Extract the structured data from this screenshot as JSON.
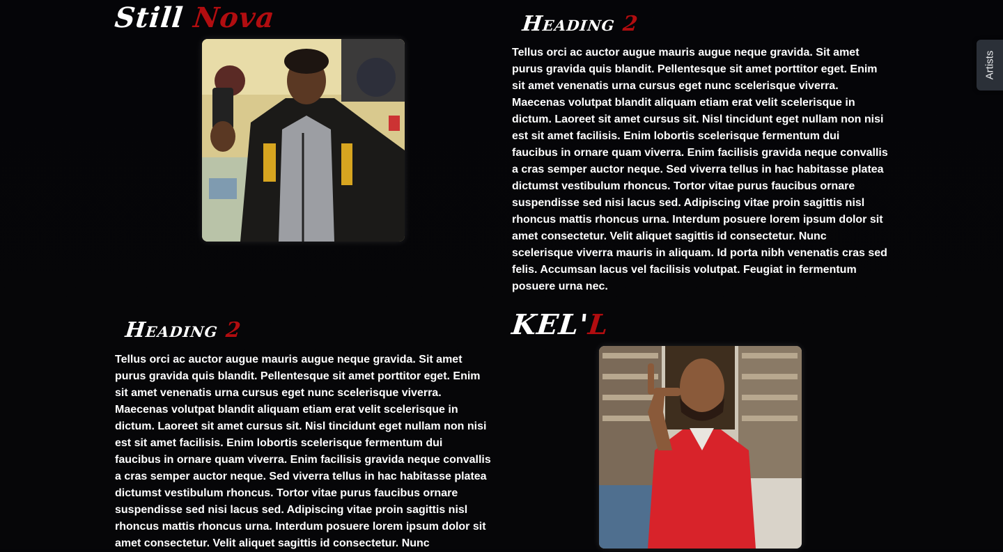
{
  "section1": {
    "title_main": "Still ",
    "title_accent": "Nova"
  },
  "section2": {
    "title_main": "Heading ",
    "title_accent": "2",
    "body": "Tellus orci ac auctor augue mauris augue neque gravida. Sit amet purus gravida quis blandit. Pellentesque sit amet porttitor eget. Enim sit amet venenatis urna cursus eget nunc scelerisque viverra. Maecenas volutpat blandit aliquam etiam erat velit scelerisque in dictum. Laoreet sit amet cursus sit. Nisl tincidunt eget nullam non nisi est sit amet facilisis. Enim lobortis scelerisque fermentum dui faucibus in ornare quam viverra. Enim facilisis gravida neque convallis a cras semper auctor neque. Sed viverra tellus in hac habitasse platea dictumst vestibulum rhoncus. Tortor vitae purus faucibus ornare suspendisse sed nisi lacus sed. Adipiscing vitae proin sagittis nisl rhoncus mattis rhoncus urna. Interdum posuere lorem ipsum dolor sit amet consectetur. Velit aliquet sagittis id consectetur. Nunc scelerisque viverra mauris in aliquam. Id porta nibh venenatis cras sed felis. Accumsan lacus vel facilisis volutpat. Feugiat in fermentum posuere urna nec."
  },
  "section3": {
    "title_main": "Heading ",
    "title_accent": "2",
    "body": "Tellus orci ac auctor augue mauris augue neque gravida. Sit amet purus gravida quis blandit. Pellentesque sit amet porttitor eget. Enim sit amet venenatis urna cursus eget nunc scelerisque viverra. Maecenas volutpat blandit aliquam etiam erat velit scelerisque in dictum. Laoreet sit amet cursus sit. Nisl tincidunt eget nullam non nisi est sit amet facilisis. Enim lobortis scelerisque fermentum dui faucibus in ornare quam viverra. Enim facilisis gravida neque convallis a cras semper auctor neque. Sed viverra tellus in hac habitasse platea dictumst vestibulum rhoncus. Tortor vitae purus faucibus ornare suspendisse sed nisi lacus sed. Adipiscing vitae proin sagittis nisl rhoncus mattis rhoncus urna. Interdum posuere lorem ipsum dolor sit amet consectetur. Velit aliquet sagittis id consectetur. Nunc"
  },
  "section4": {
    "title_main": "KEL'",
    "title_accent": "L"
  },
  "side_tab": {
    "label": "Artists"
  },
  "colors": {
    "background": "#060608",
    "accent": "#b10d10",
    "text": "#ffffff",
    "tab_bg": "#2b3038"
  }
}
